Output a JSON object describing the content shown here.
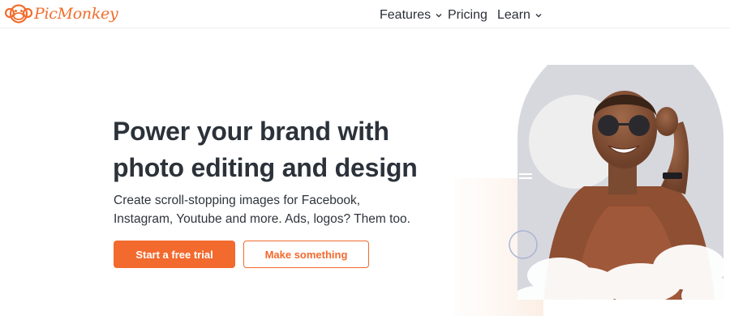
{
  "brand": {
    "name": "PicMonkey",
    "accent": "#f26a2e"
  },
  "nav": {
    "items": [
      {
        "label": "Features",
        "has_dropdown": true
      },
      {
        "label": "Pricing",
        "has_dropdown": false
      },
      {
        "label": "Learn",
        "has_dropdown": true
      }
    ]
  },
  "hero": {
    "title_line1": "Power your brand with",
    "title_line2": "photo editing and design",
    "subtitle_line1": "Create scroll-stopping images for Facebook,",
    "subtitle_line2": "Instagram, Youtube and more. Ads, logos? Them too.",
    "primary_cta": "Start a free trial",
    "secondary_cta": "Make something"
  },
  "icons": {
    "logo": "monkey-face-icon",
    "dropdown": "chevron-down-icon"
  }
}
